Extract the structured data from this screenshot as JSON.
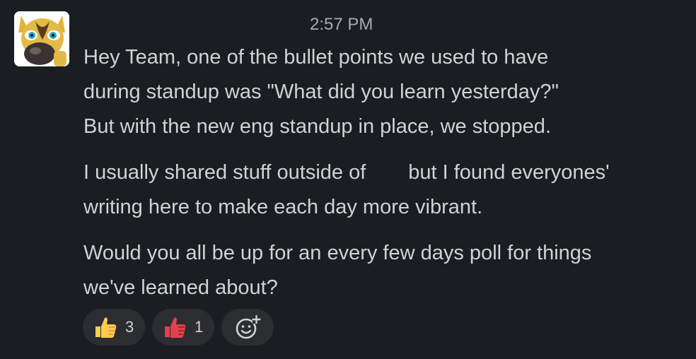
{
  "message": {
    "timestamp": "2:57 PM",
    "paragraphs": [
      {
        "lines": [
          "Hey Team, one of the bullet points we used to have",
          "during standup was \"What did you learn yesterday?\"",
          "But with the new eng standup in place, we stopped."
        ]
      },
      {
        "lines_parts": {
          "line1_before": "I usually shared stuff outside of",
          "line1_after": "but I found everyones'",
          "line2": "writing here to make each day more vibrant."
        }
      },
      {
        "lines": [
          "Would you all be up for an every few days poll for things",
          "we've learned about?"
        ]
      }
    ]
  },
  "reactions": [
    {
      "icon": "thumbs-up-icon",
      "count": "3"
    },
    {
      "icon": "thumbs-down-icon",
      "count": "1"
    }
  ],
  "add_reaction": {
    "icon": "add-reaction-icon"
  },
  "colors": {
    "background": "#1a1d21",
    "text": "#d1d2d3",
    "muted": "#ababad",
    "pill": "#2b2d31"
  }
}
